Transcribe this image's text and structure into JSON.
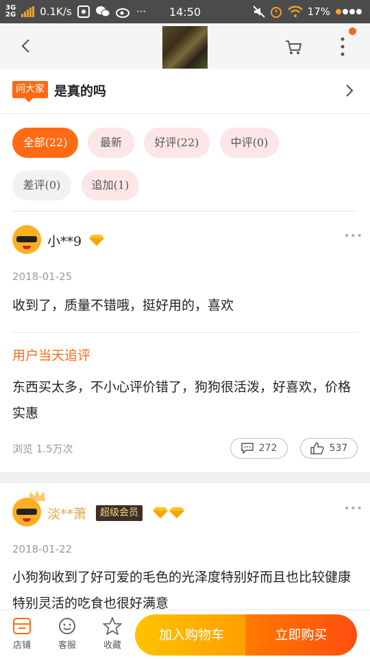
{
  "status_bar": {
    "net1": "3G",
    "net2": "2G",
    "speed": "0.1K/s",
    "time": "14:50",
    "battery": "17%"
  },
  "question": {
    "badge": "问大家",
    "text": "是真的吗"
  },
  "filters": [
    {
      "label": "全部(22)"
    },
    {
      "label": "最新"
    },
    {
      "label": "好评(22)"
    },
    {
      "label": "中评(0)"
    },
    {
      "label": "差评(0)"
    },
    {
      "label": "追加(1)"
    }
  ],
  "reviews": [
    {
      "username": "小**9",
      "date": "2018-01-25",
      "content": "收到了，质量不错哦，挺好用的，喜欢",
      "followup_title": "用户当天追评",
      "followup_content": "东西买太多，不小心评价错了，狗狗很活泼，好喜欢，价格实惠",
      "views": "浏览 1.5万次",
      "comments": "272",
      "likes": "537"
    },
    {
      "username": "淡**萧",
      "vip_badge": "超级会员",
      "date": "2018-01-22",
      "content": "小狗狗收到了好可爱的毛色的光泽度特别好而且也比较健康特别灵活的吃食也很好满意"
    }
  ],
  "bottom_bar": {
    "store": "店铺",
    "service": "客服",
    "favorite": "收藏",
    "add_to_cart": "加入购物车",
    "buy_now": "立即购买"
  },
  "colors": {
    "accent": "#ff6a13",
    "status_bar": "#4b4b4b"
  }
}
